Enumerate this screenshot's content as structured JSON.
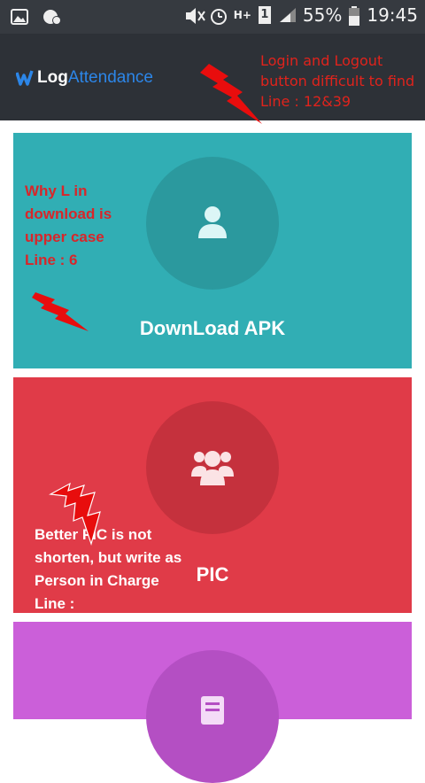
{
  "statusbar": {
    "battery": "55%",
    "time": "19:45",
    "network_type": "H+",
    "sim_slot": "1",
    "icons": [
      "image-icon",
      "app-notification-icon",
      "mute-icon",
      "alarm-icon",
      "network-icon",
      "sim-icon",
      "signal-icon",
      "battery-icon"
    ]
  },
  "app": {
    "brand_log": "Log",
    "brand_attendance": "Attendance"
  },
  "annotations": {
    "header_note_1": "Login and Logout",
    "header_note_2": "button difficult to find",
    "header_note_3": "Line : 12&39",
    "download_note_1": "Why L in",
    "download_note_2": "download is",
    "download_note_3": "upper case",
    "download_note_4": "Line :  6",
    "pic_note_1": "Better PIC is not",
    "pic_note_2": "shorten, but write as",
    "pic_note_3": "Person in Charge",
    "pic_note_4": "Line :"
  },
  "cards": {
    "download_label": "DownLoad APK",
    "pic_label": "PIC"
  },
  "colors": {
    "status_bg": "#363a40",
    "header_bg": "#2d3137",
    "brand_blue": "#2c86e8",
    "teal": "#31aeb4",
    "red": "#e03b48",
    "purple": "#cb5fd9",
    "annotation_red": "#e0231c"
  }
}
